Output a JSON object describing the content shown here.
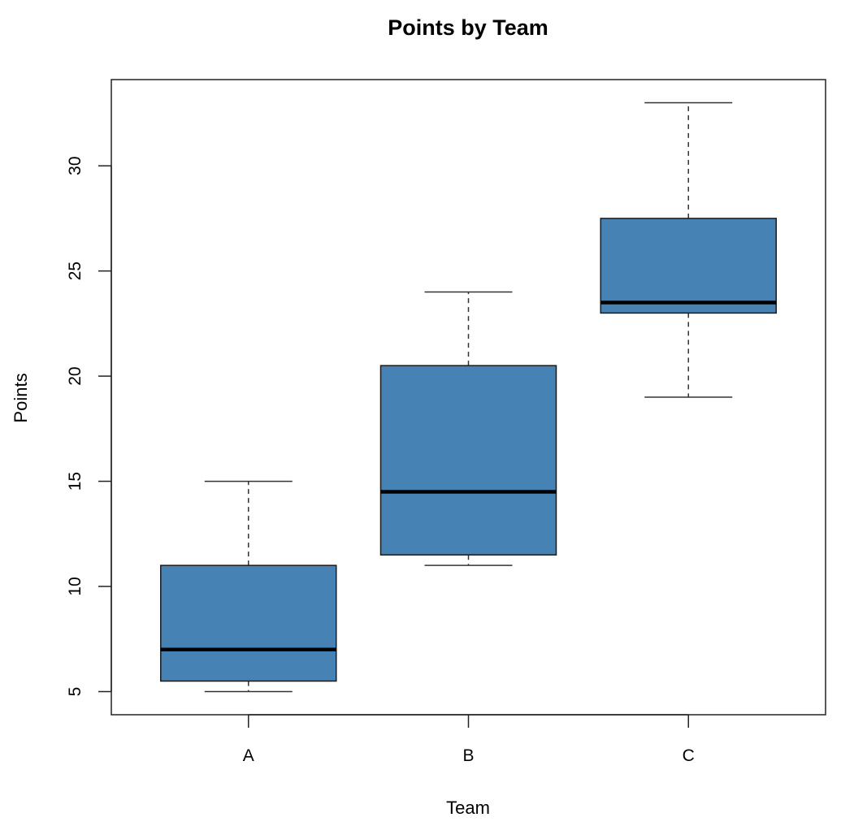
{
  "chart_data": {
    "type": "boxplot",
    "title": "Points by Team",
    "xlabel": "Team",
    "ylabel": "Points",
    "categories": [
      "A",
      "B",
      "C"
    ],
    "ylim": [
      3.9,
      34.1
    ],
    "yticks": [
      5,
      10,
      15,
      20,
      25,
      30
    ],
    "ytick_labels": [
      "5",
      "10",
      "15",
      "20",
      "25",
      "30"
    ],
    "grid": false,
    "legend": "none",
    "box_color": "#4682B4",
    "series": [
      {
        "name": "A",
        "min": 5,
        "q1": 5.5,
        "median": 7,
        "q3": 11,
        "max": 15
      },
      {
        "name": "B",
        "min": 11,
        "q1": 11.5,
        "median": 14.5,
        "q3": 20.5,
        "max": 24
      },
      {
        "name": "C",
        "min": 19,
        "q1": 23,
        "median": 23.5,
        "q3": 27.5,
        "max": 33
      }
    ]
  }
}
